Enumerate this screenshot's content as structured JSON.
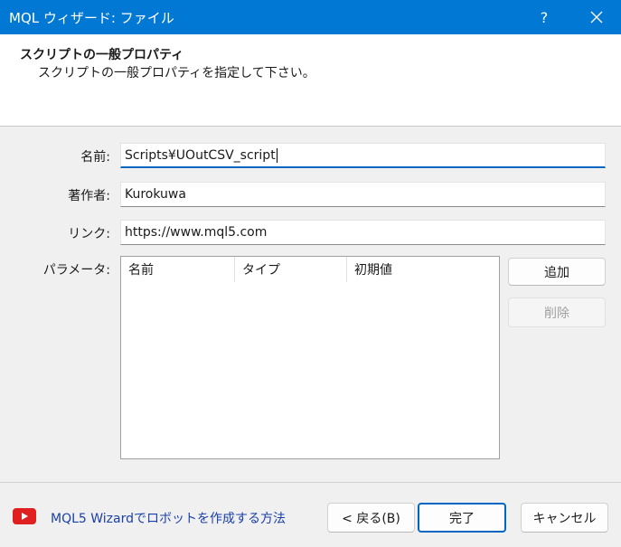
{
  "window": {
    "title": "MQL ウィザード: ファイル",
    "help_label": "?"
  },
  "header": {
    "title": "スクリプトの一般プロパティ",
    "subtitle": "スクリプトの一般プロパティを指定して下さい。"
  },
  "form": {
    "name_label": "名前:",
    "name_value": "Scripts¥UOutCSV_script",
    "author_label": "著作者:",
    "author_value": "Kurokuwa",
    "link_label": "リンク:",
    "link_value": "https://www.mql5.com",
    "params_label": "パラメータ:"
  },
  "params_table": {
    "columns": [
      "名前",
      "タイプ",
      "初期値"
    ]
  },
  "side_buttons": {
    "add_label": "追加",
    "delete_label": "削除"
  },
  "footer": {
    "link_text": "MQL5 Wizardでロボットを作成する方法",
    "back_label": "< 戻る(B)",
    "finish_label": "完了",
    "cancel_label": "キャンセル"
  },
  "colors": {
    "titlebar": "#0078d4",
    "link": "#1a3fa8",
    "youtube": "#e02020"
  }
}
